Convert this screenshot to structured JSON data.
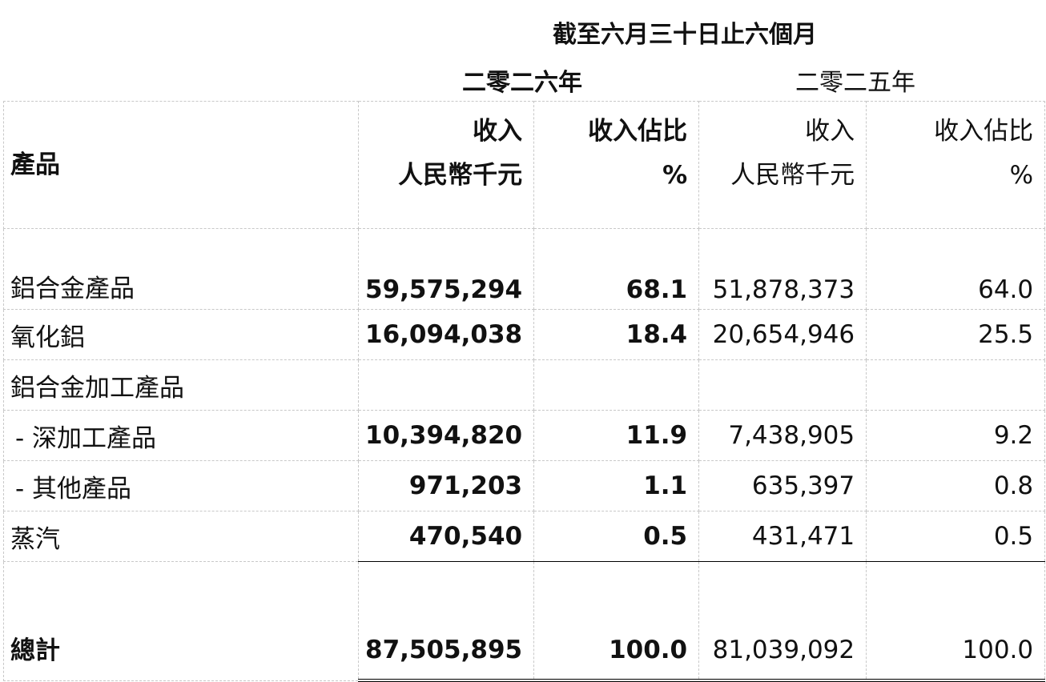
{
  "header": {
    "period": "截至六月三十日止六個月",
    "year_2026": "二零二六年",
    "year_2025": "二零二五年"
  },
  "columns": {
    "product": "產品",
    "revenue_line1": "收入",
    "revenue_line2": "人民幣千元",
    "share_line1": "收入佔比",
    "share_line2": "%"
  },
  "rows": [
    {
      "label": "鋁合金產品",
      "rev_2026": "59,575,294",
      "pct_2026": "68.1",
      "rev_2025": "51,878,373",
      "pct_2025": "64.0"
    },
    {
      "label": "氧化鋁",
      "rev_2026": "16,094,038",
      "pct_2026": "18.4",
      "rev_2025": "20,654,946",
      "pct_2025": "25.5"
    },
    {
      "label": "鋁合金加工產品",
      "rev_2026": "",
      "pct_2026": "",
      "rev_2025": "",
      "pct_2025": ""
    },
    {
      "label": "- 深加工產品",
      "rev_2026": "10,394,820",
      "pct_2026": "11.9",
      "rev_2025": "7,438,905",
      "pct_2025": "9.2"
    },
    {
      "label": "- 其他產品",
      "rev_2026": "971,203",
      "pct_2026": "1.1",
      "rev_2025": "635,397",
      "pct_2025": "0.8"
    },
    {
      "label": "蒸汽",
      "rev_2026": "470,540",
      "pct_2026": "0.5",
      "rev_2025": "431,471",
      "pct_2025": "0.5"
    }
  ],
  "total": {
    "label": "總計",
    "rev_2026": "87,505,895",
    "pct_2026": "100.0",
    "rev_2025": "81,039,092",
    "pct_2025": "100.0"
  }
}
